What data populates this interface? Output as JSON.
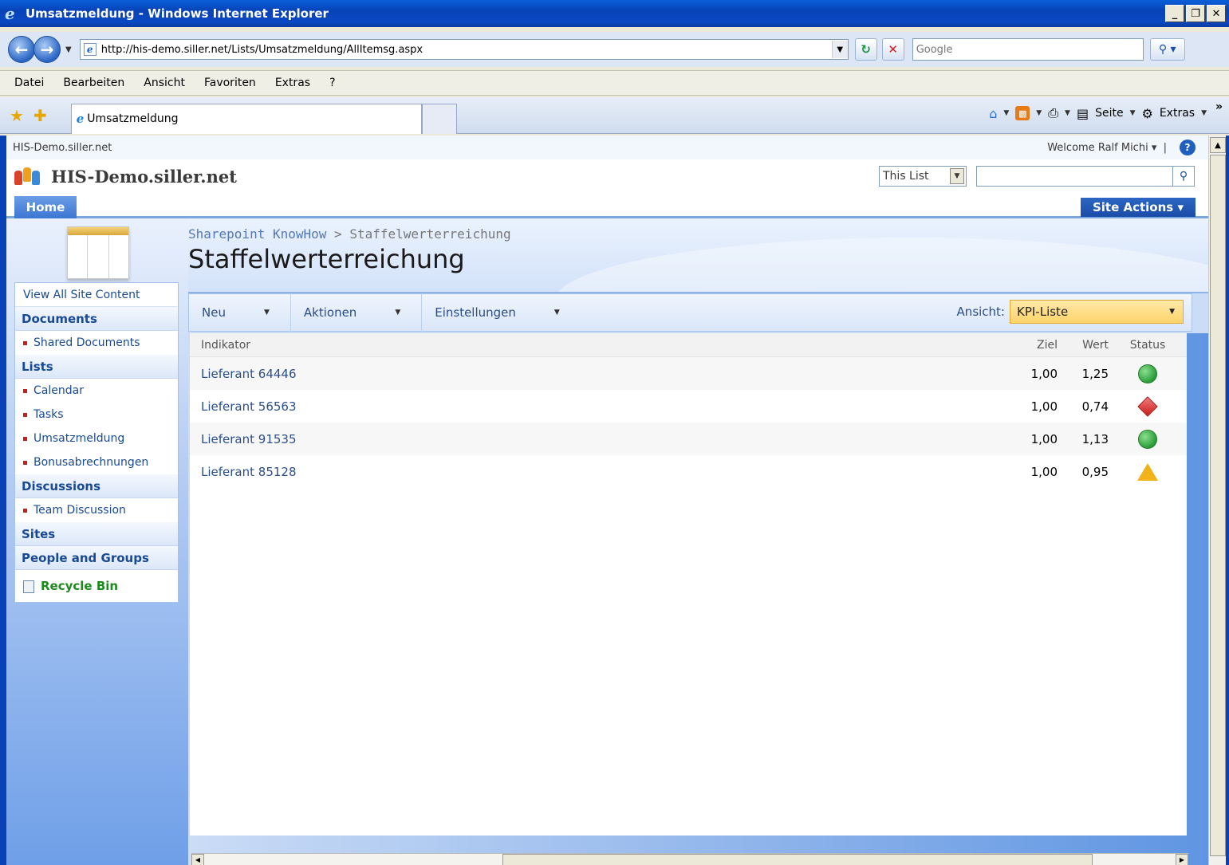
{
  "window": {
    "title": "Umsatzmeldung - Windows Internet Explorer",
    "controls": [
      "_",
      "❐",
      "✕"
    ]
  },
  "addressbar": {
    "url": "http://his-demo.siller.net/Lists/Umsatzmeldung/AllItemsg.aspx",
    "search_placeholder": "Google"
  },
  "menu": [
    "Datei",
    "Bearbeiten",
    "Ansicht",
    "Favoriten",
    "Extras",
    "?"
  ],
  "tab": {
    "label": "Umsatzmeldung"
  },
  "commandbar": {
    "page_label": "Seite",
    "tools_label": "Extras"
  },
  "sharepoint": {
    "global_site": "HIS-Demo.siller.net",
    "welcome": "Welcome Ralf Michi",
    "site_title": "HIS-Demo.siller.net",
    "scope": "This List",
    "home_tab": "Home",
    "site_actions": "Site Actions"
  },
  "quicklaunch": {
    "view_all": "View All Site Content",
    "documents_head": "Documents",
    "documents": [
      "Shared Documents"
    ],
    "lists_head": "Lists",
    "lists": [
      "Calendar",
      "Tasks",
      "Umsatzmeldung",
      "Bonusabrechnungen"
    ],
    "discussions_head": "Discussions",
    "discussions": [
      "Team Discussion"
    ],
    "sites_head": "Sites",
    "people_head": "People and Groups",
    "recycle": "Recycle Bin"
  },
  "page": {
    "breadcrumb_root": "Sharepoint KnowHow",
    "breadcrumb_sep": ">",
    "breadcrumb_current": "Staffelwerterreichung",
    "title": "Staffelwerterreichung"
  },
  "toolbar": {
    "neu": "Neu",
    "aktionen": "Aktionen",
    "einstellungen": "Einstellungen",
    "view_label": "Ansicht:",
    "view_value": "KPI-Liste"
  },
  "table": {
    "headers": {
      "indicator": "Indikator",
      "goal": "Ziel",
      "value": "Wert",
      "status": "Status"
    },
    "rows": [
      {
        "indicator": "Lieferant 64446",
        "goal": "1,00",
        "value": "1,25",
        "status": "green"
      },
      {
        "indicator": "Lieferant 56563",
        "goal": "1,00",
        "value": "0,74",
        "status": "red"
      },
      {
        "indicator": "Lieferant 91535",
        "goal": "1,00",
        "value": "1,13",
        "status": "green"
      },
      {
        "indicator": "Lieferant 85128",
        "goal": "1,00",
        "value": "0,95",
        "status": "yellow"
      }
    ]
  }
}
